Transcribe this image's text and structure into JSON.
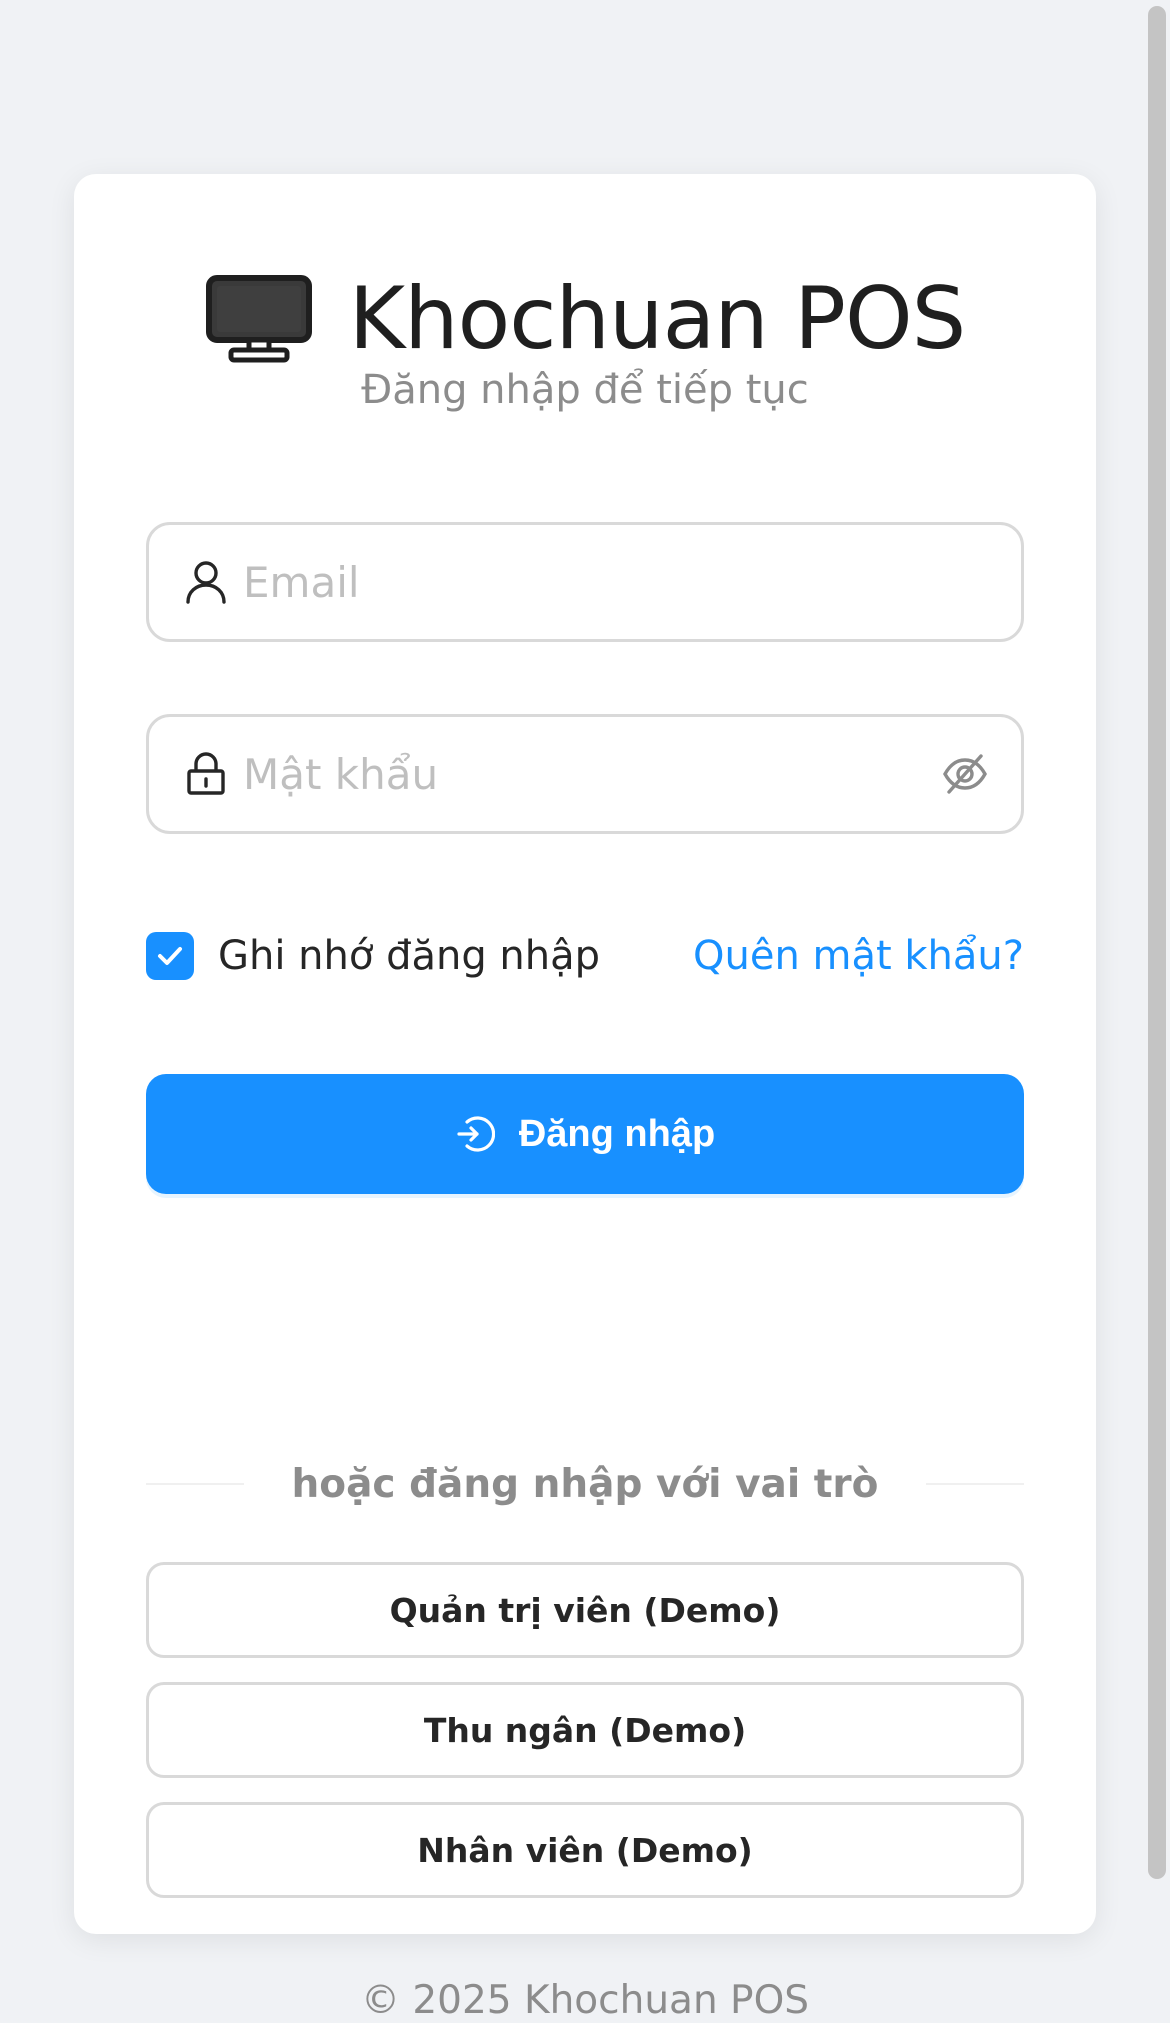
{
  "app": {
    "title": "Khochuan POS",
    "subtitle": "Đăng nhập để tiếp tục",
    "logo_icon": "monitor-icon"
  },
  "form": {
    "email": {
      "placeholder": "Email",
      "value": "",
      "icon": "user-icon"
    },
    "password": {
      "placeholder": "Mật khẩu",
      "value": "",
      "icon": "lock-icon",
      "toggle_icon": "eye-off-icon"
    },
    "remember": {
      "label": "Ghi nhớ đăng nhập",
      "checked": true
    },
    "forgot_label": "Quên mật khẩu?",
    "submit_label": "Đăng nhập",
    "submit_icon": "login-icon"
  },
  "divider_text": "hoặc đăng nhập với vai trò",
  "roles": [
    {
      "label": "Quản trị viên (Demo)"
    },
    {
      "label": "Thu ngân (Demo)"
    },
    {
      "label": "Nhân viên (Demo)"
    }
  ],
  "footer": "© 2025 Khochuan POS",
  "colors": {
    "accent": "#1890ff",
    "background": "#f0f2f5",
    "card": "#ffffff",
    "muted_text": "#8c8c8c",
    "border": "#d9d9d9"
  }
}
